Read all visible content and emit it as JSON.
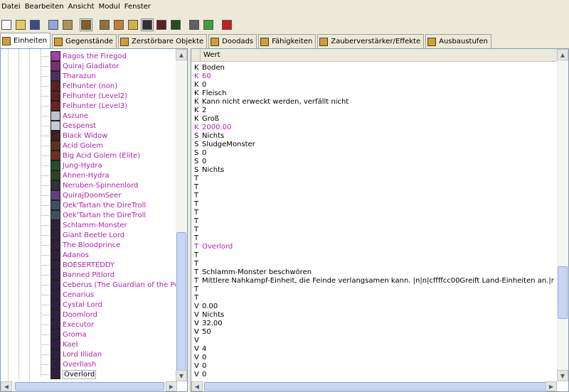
{
  "menu": [
    "Datei",
    "Bearbeiten",
    "Ansicht",
    "Modul",
    "Fenster"
  ],
  "toolbar": [
    {
      "name": "new-file-icon",
      "color": "#ffffff"
    },
    {
      "name": "open-folder-icon",
      "color": "#e8c85a"
    },
    {
      "name": "save-icon",
      "color": "#3a4a8a"
    },
    {
      "sep": true
    },
    {
      "name": "copy-icon",
      "color": "#8ea6d8"
    },
    {
      "name": "paste-icon",
      "color": "#b09060"
    },
    {
      "sep": true
    },
    {
      "name": "unit-editor-icon",
      "color": "#806020",
      "active": true
    },
    {
      "sep": true
    },
    {
      "name": "terrain-editor-icon",
      "color": "#907040"
    },
    {
      "name": "trigger-editor-icon",
      "color": "#c08030"
    },
    {
      "name": "sound-editor-icon",
      "color": "#d0b040"
    },
    {
      "name": "object-editor-icon",
      "color": "#303030",
      "active": true
    },
    {
      "name": "campaign-editor-icon",
      "color": "#602020"
    },
    {
      "name": "ai-editor-icon",
      "color": "#205020"
    },
    {
      "sep": true
    },
    {
      "name": "import-manager-icon",
      "color": "#606060"
    },
    {
      "name": "test-map-icon",
      "color": "#40a040"
    },
    {
      "sep": true
    },
    {
      "name": "object-manager-icon",
      "color": "#c02020"
    }
  ],
  "tabs": [
    {
      "label": "Einheiten",
      "selected": true,
      "icon": "units-tab-icon"
    },
    {
      "label": "Gegenstände",
      "icon": "items-tab-icon"
    },
    {
      "label": "Zerstörbare Objekte",
      "icon": "destructibles-tab-icon"
    },
    {
      "label": "Doodads",
      "icon": "doodads-tab-icon"
    },
    {
      "label": "Fähigkeiten",
      "icon": "abilities-tab-icon"
    },
    {
      "label": "Zauberverstärker/Effekte",
      "icon": "buffs-tab-icon"
    },
    {
      "label": "Ausbaustufen",
      "icon": "upgrades-tab-icon"
    }
  ],
  "units": [
    {
      "label": "Ragos the Firegod",
      "color": "#a040a0"
    },
    {
      "label": "Quiraj Gladiator",
      "color": "#7a3070"
    },
    {
      "label": "Tharazun",
      "color": "#503060"
    },
    {
      "label": "Felhunter (non)",
      "color": "#602020"
    },
    {
      "label": "Felhunter (Level2)",
      "color": "#602020"
    },
    {
      "label": "Felhunter (Level3)",
      "color": "#702028"
    },
    {
      "label": "Aszune",
      "color": "#c0c0d0"
    },
    {
      "label": "Gespenst",
      "color": "#c8c8d8"
    },
    {
      "label": "Black Widow",
      "color": "#402020"
    },
    {
      "label": "Acid Golem",
      "color": "#603020"
    },
    {
      "label": "Big Acid Golem (Elite)",
      "color": "#703020"
    },
    {
      "label": "Jung-Hydra",
      "color": "#205030"
    },
    {
      "label": "Ahnen-Hydra",
      "color": "#304020"
    },
    {
      "label": "Neruben-Spinnenlord",
      "color": "#303040"
    },
    {
      "label": "QuirajDoomSeer",
      "color": "#604080"
    },
    {
      "label": "Oek'Tartan the DireTroll",
      "color": "#405060"
    },
    {
      "label": "Oek'Tartan the DireTroll",
      "color": "#405060"
    },
    {
      "label": "Schlamm-Monster",
      "color": "#302040"
    },
    {
      "label": "Giant Beetle Lord",
      "color": "#302040"
    },
    {
      "label": "The Bloodprince",
      "color": "#302040"
    },
    {
      "label": "Adanos",
      "color": "#302040"
    },
    {
      "label": "BOESERTEDDY",
      "color": "#302040"
    },
    {
      "label": "Banned Pitlord",
      "color": "#302040"
    },
    {
      "label": "Ceberus (The Guardian of the Portal)",
      "color": "#302040"
    },
    {
      "label": "Cenarius",
      "color": "#302040"
    },
    {
      "label": "Cystal Lord",
      "color": "#302040"
    },
    {
      "label": "Doomlord",
      "color": "#302040"
    },
    {
      "label": "Executor",
      "color": "#302040"
    },
    {
      "label": "Groma",
      "color": "#302040"
    },
    {
      "label": "Kael",
      "color": "#302040"
    },
    {
      "label": "Lord Illidan",
      "color": "#302040"
    },
    {
      "label": "Overllash",
      "color": "#302040"
    },
    {
      "label": "Overlord",
      "color": "#302040",
      "selected": true
    }
  ],
  "grid": {
    "header": "Wert",
    "rows": [
      {
        "t": "K",
        "v": "Boden"
      },
      {
        "t": "K",
        "v": "60",
        "pink": true
      },
      {
        "t": "K",
        "v": "0"
      },
      {
        "t": "K",
        "v": "Fleisch"
      },
      {
        "t": "K",
        "v": "Kann nicht erweckt werden, verfällt nicht"
      },
      {
        "t": "K",
        "v": "2"
      },
      {
        "t": "K",
        "v": "Groß"
      },
      {
        "t": "K",
        "v": "2000.00",
        "pink": true
      },
      {
        "t": "S",
        "v": "Nichts"
      },
      {
        "t": "S",
        "v": "SludgeMonster"
      },
      {
        "t": "S",
        "v": "0"
      },
      {
        "t": "S",
        "v": "0"
      },
      {
        "t": "S",
        "v": "Nichts"
      },
      {
        "t": "T",
        "v": ""
      },
      {
        "t": "T",
        "v": ""
      },
      {
        "t": "T",
        "v": ""
      },
      {
        "t": "T",
        "v": ""
      },
      {
        "t": "T",
        "v": ""
      },
      {
        "t": "T",
        "v": ""
      },
      {
        "t": "T",
        "v": ""
      },
      {
        "t": "T",
        "v": ""
      },
      {
        "t": "T",
        "v": "Overlord",
        "pink": true
      },
      {
        "t": "T",
        "v": ""
      },
      {
        "t": "T",
        "v": ""
      },
      {
        "t": "T",
        "v": "Schlamm-Monster beschwören"
      },
      {
        "t": "T",
        "v": "Mittlere Nahkampf-Einheit, die Feinde verlangsamen kann. |n|n|cffffcc00Greift Land-Einheiten an.|r"
      },
      {
        "t": "T",
        "v": ""
      },
      {
        "t": "T",
        "v": ""
      },
      {
        "t": "V",
        "v": "0.00"
      },
      {
        "t": "V",
        "v": "Nichts"
      },
      {
        "t": "V",
        "v": "32.00"
      },
      {
        "t": "V",
        "v": "50"
      },
      {
        "t": "V",
        "v": ""
      },
      {
        "t": "V",
        "v": "4"
      },
      {
        "t": "V",
        "v": "0"
      },
      {
        "t": "V",
        "v": "0"
      },
      {
        "t": "V",
        "v": "0"
      }
    ]
  }
}
